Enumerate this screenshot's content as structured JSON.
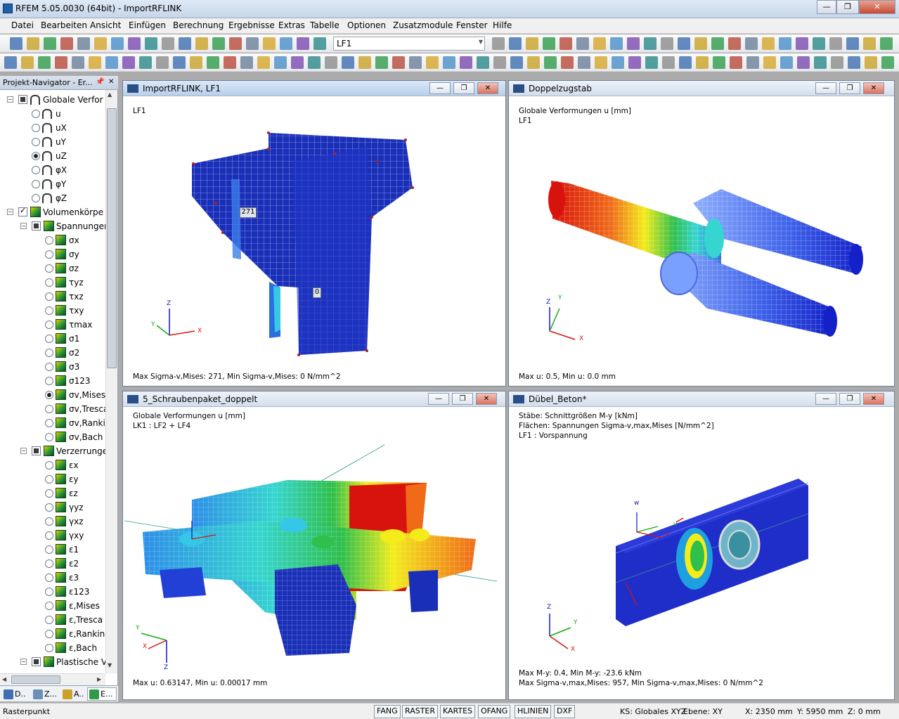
{
  "app": {
    "title": "RFEM 5.05.0030 (64bit) - ImportRFLINK",
    "win_min": "—",
    "win_restore": "❐",
    "win_close": "✕"
  },
  "menu": [
    "Datei",
    "Bearbeiten",
    "Ansicht",
    "Einfügen",
    "Berechnung",
    "Ergebnisse",
    "Extras",
    "Tabelle",
    "Optionen",
    "Zusatzmodule",
    "Fenster",
    "Hilfe"
  ],
  "toolbar": {
    "loadcase_value": "LF1"
  },
  "navigator": {
    "title": "Projekt-Navigator - Er...",
    "pin": "📌",
    "close": "✕",
    "tree": [
      {
        "label": "Globale Verfor",
        "level": 0,
        "kind": "group-deform"
      },
      {
        "label": "u",
        "level": 1,
        "kind": "radio-deform",
        "on": false
      },
      {
        "label": "uX",
        "level": 1,
        "kind": "radio-deform",
        "on": false
      },
      {
        "label": "uY",
        "level": 1,
        "kind": "radio-deform",
        "on": false
      },
      {
        "label": "uZ",
        "level": 1,
        "kind": "radio-deform",
        "on": true
      },
      {
        "label": "φX",
        "level": 1,
        "kind": "radio-deform",
        "on": false
      },
      {
        "label": "φY",
        "level": 1,
        "kind": "radio-deform",
        "on": false
      },
      {
        "label": "φZ",
        "level": 1,
        "kind": "radio-deform",
        "on": false
      },
      {
        "label": "Volumenkörpe",
        "level": 0,
        "kind": "group-solid-checked"
      },
      {
        "label": "Spannunger",
        "level": 1,
        "kind": "group-solid"
      },
      {
        "label": "σx",
        "level": 2,
        "kind": "radio-solid",
        "on": false
      },
      {
        "label": "σy",
        "level": 2,
        "kind": "radio-solid",
        "on": false
      },
      {
        "label": "σz",
        "level": 2,
        "kind": "radio-solid",
        "on": false
      },
      {
        "label": "τyz",
        "level": 2,
        "kind": "radio-solid",
        "on": false
      },
      {
        "label": "τxz",
        "level": 2,
        "kind": "radio-solid",
        "on": false
      },
      {
        "label": "τxy",
        "level": 2,
        "kind": "radio-solid",
        "on": false
      },
      {
        "label": "τmax",
        "level": 2,
        "kind": "radio-solid",
        "on": false
      },
      {
        "label": "σ1",
        "level": 2,
        "kind": "radio-solid",
        "on": false
      },
      {
        "label": "σ2",
        "level": 2,
        "kind": "radio-solid",
        "on": false
      },
      {
        "label": "σ3",
        "level": 2,
        "kind": "radio-solid",
        "on": false
      },
      {
        "label": "σ123",
        "level": 2,
        "kind": "radio-solid",
        "on": false
      },
      {
        "label": "σv,Mises",
        "level": 2,
        "kind": "radio-solid",
        "on": true
      },
      {
        "label": "σv,Tresca",
        "level": 2,
        "kind": "radio-solid",
        "on": false
      },
      {
        "label": "σv,Rankir",
        "level": 2,
        "kind": "radio-solid",
        "on": false
      },
      {
        "label": "σv,Bach",
        "level": 2,
        "kind": "radio-solid",
        "on": false
      },
      {
        "label": "Verzerrunge",
        "level": 1,
        "kind": "group-solid"
      },
      {
        "label": "εx",
        "level": 2,
        "kind": "radio-solid",
        "on": false
      },
      {
        "label": "εy",
        "level": 2,
        "kind": "radio-solid",
        "on": false
      },
      {
        "label": "εz",
        "level": 2,
        "kind": "radio-solid",
        "on": false
      },
      {
        "label": "γyz",
        "level": 2,
        "kind": "radio-solid",
        "on": false
      },
      {
        "label": "γxz",
        "level": 2,
        "kind": "radio-solid",
        "on": false
      },
      {
        "label": "γxy",
        "level": 2,
        "kind": "radio-solid",
        "on": false
      },
      {
        "label": "ε1",
        "level": 2,
        "kind": "radio-solid",
        "on": false
      },
      {
        "label": "ε2",
        "level": 2,
        "kind": "radio-solid",
        "on": false
      },
      {
        "label": "ε3",
        "level": 2,
        "kind": "radio-solid",
        "on": false
      },
      {
        "label": "ε123",
        "level": 2,
        "kind": "radio-solid",
        "on": false
      },
      {
        "label": "ε,Mises",
        "level": 2,
        "kind": "radio-solid",
        "on": false
      },
      {
        "label": "ε,Tresca",
        "level": 2,
        "kind": "radio-solid",
        "on": false
      },
      {
        "label": "ε,Rankine",
        "level": 2,
        "kind": "radio-solid",
        "on": false
      },
      {
        "label": "ε,Bach",
        "level": 2,
        "kind": "radio-solid",
        "on": false
      },
      {
        "label": "Plastische V",
        "level": 1,
        "kind": "group-solid"
      }
    ],
    "tabs": [
      {
        "label": "D..",
        "active": false,
        "color": "#3f6fb0"
      },
      {
        "label": "Z...",
        "active": false,
        "color": "#6b8fb8"
      },
      {
        "label": "A..",
        "active": false,
        "color": "#c9a227"
      },
      {
        "label": "E...",
        "active": true,
        "color": "#2f9b4a"
      }
    ]
  },
  "windows": {
    "w1": {
      "title": "ImportRFLINK, LF1",
      "lines": [
        "LF1"
      ],
      "footer": [
        "Max Sigma-v,Mises: 271, Min Sigma-v,Mises: 0 N/mm^2"
      ],
      "label_max": "271",
      "label_min": "0",
      "axes": {
        "x": "X",
        "y": "Y",
        "z": "Z"
      }
    },
    "w2": {
      "title": "Doppelzugstab",
      "lines": [
        "Globale Verformungen u [mm]",
        "LF1"
      ],
      "footer": [
        "Max u: 0.5, Min u: 0.0 mm"
      ],
      "axes": {
        "x": "X",
        "y": "Y",
        "z": "Z"
      }
    },
    "w3": {
      "title": "5_Schraubenpaket_doppelt",
      "lines": [
        "Globale Verformungen u [mm]",
        "LK1 : LF2 + LF4"
      ],
      "footer": [
        "Max u: 0.63147, Min u: 0.00017 mm"
      ],
      "axes": {
        "x": "X",
        "y": "Y",
        "z": "Z"
      }
    },
    "w4": {
      "title": "Dübel_Beton*",
      "lines": [
        "Stäbe: Schnittgrößen M-y [kNm]",
        "Flächen: Spannungen Sigma-v,max,Mises [N/mm^2]",
        "LF1 : Vorspannung"
      ],
      "footer": [
        "Max M-y: 0.4, Min M-y: -23.6 kNm",
        "Max Sigma-v,max,Mises: 957, Min Sigma-v,max,Mises: 0 N/mm^2"
      ],
      "axes": {
        "x": "X",
        "y": "Y",
        "z": "Z"
      },
      "local_axes": {
        "w": "w",
        "v": "v",
        "u": "u"
      }
    }
  },
  "window_controls": {
    "min": "—",
    "restore": "❐",
    "close": "✕"
  },
  "statusbar": {
    "left": "Rasterpunkt",
    "buttons": [
      "FANG",
      "RASTER",
      "KARTES",
      "OFANG",
      "HLINIEN",
      "DXF"
    ],
    "ks": "KS: Globales XYZ",
    "ebene": "Ebene: XY",
    "x": "X:  2350 mm",
    "y": "Y:  5950 mm",
    "z": "Z:  0 mm"
  },
  "colors": {
    "accent": "#1f5fa8",
    "mesh_blue": "#1a2fb8",
    "stress_red": "#d8120c",
    "stress_yellow": "#f3ec1a",
    "stress_green": "#2fbf4a",
    "stress_cyan": "#35d6d0"
  }
}
